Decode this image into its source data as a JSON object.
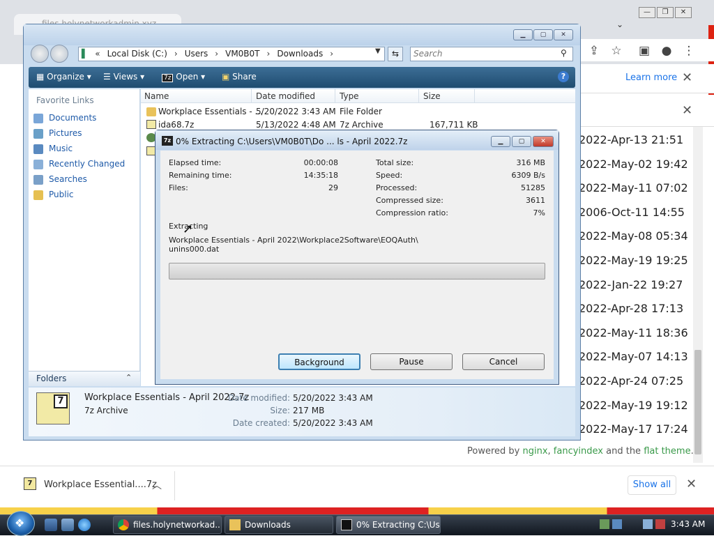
{
  "chrome": {
    "tab_title": "files.holynetworkadmin.xyz",
    "learn_more": "Learn more",
    "dates": [
      "2022-Apr-13 21:51",
      "2022-May-02 19:42",
      "2022-May-11 07:02",
      "2006-Oct-11 14:55",
      "2022-May-08 05:34",
      "2022-May-19 19:25",
      "2022-Jan-22 19:27",
      "2022-Apr-28 17:13",
      "2022-May-11 18:36",
      "2022-May-07 14:13",
      "2022-Apr-24 07:25",
      "2022-May-19 19:12",
      "2022-May-17 17:24"
    ],
    "powered_prefix": "Powered by ",
    "powered_nginx": "nginx",
    "powered_comma": ", ",
    "powered_fancyindex": "fancyindex",
    "powered_and": " and the ",
    "powered_flat": "flat theme",
    "powered_end": "."
  },
  "download_bar": {
    "file_name": "Workplace Essential....7z",
    "show_all": "Show all"
  },
  "explorer": {
    "address": [
      "Local Disk (C:)",
      "Users",
      "VM0B0T",
      "Downloads"
    ],
    "search_placeholder": "Search",
    "toolbar": {
      "organize": "Organize",
      "views": "Views",
      "open": "Open",
      "share": "Share"
    },
    "favorite_links_title": "Favorite Links",
    "favorites": [
      "Documents",
      "Pictures",
      "Music",
      "Recently Changed",
      "Searches",
      "Public"
    ],
    "folders_label": "Folders",
    "columns": {
      "name": "Name",
      "date": "Date modified",
      "type": "Type",
      "size": "Size"
    },
    "files": [
      {
        "name": "Workplace Essentials - ...",
        "date": "5/20/2022 3:43 AM",
        "type": "File Folder",
        "size": ""
      },
      {
        "name": "ida68.7z",
        "date": "5/13/2022 4:48 AM",
        "type": "7z Archive",
        "size": "167,711 KB"
      }
    ],
    "details": {
      "name": "Workplace Essentials - April 2022.7z",
      "type": "7z Archive",
      "date_modified_label": "Date modified:",
      "date_modified": "5/20/2022 3:43 AM",
      "size_label": "Size:",
      "size": "217 MB",
      "date_created_label": "Date created:",
      "date_created": "5/20/2022 3:43 AM"
    }
  },
  "dialog": {
    "title": "0% Extracting C:\\Users\\VM0B0T\\Do ... ls - April 2022.7z",
    "icon_text": "7z",
    "left_stats": [
      {
        "label": "Elapsed time:",
        "value": "00:00:08"
      },
      {
        "label": "Remaining time:",
        "value": "14:35:18"
      },
      {
        "label": "Files:",
        "value": "29"
      }
    ],
    "right_stats": [
      {
        "label": "Total size:",
        "value": "316 MB"
      },
      {
        "label": "Speed:",
        "value": "6309 B/s"
      },
      {
        "label": "Processed:",
        "value": "51285"
      },
      {
        "label": "Compressed size:",
        "value": "3611"
      },
      {
        "label": "Compression ratio:",
        "value": "7%"
      }
    ],
    "action": "Extracting",
    "path_line1": "Workplace Essentials - April 2022\\Workplace2Software\\EOQAuth\\",
    "path_line2": "unins000.dat",
    "progress_fraction": 0.0,
    "buttons": {
      "background": "Background",
      "pause": "Pause",
      "cancel": "Cancel"
    }
  },
  "taskbar": {
    "items": [
      "files.holynetworkad...",
      "Downloads",
      "0% Extracting C:\\Us..."
    ],
    "clock": "3:43 AM"
  },
  "colors": {
    "accent": "#1a73e8",
    "explorer_frame": "#c9dcef",
    "command_bar": "#2b5a80",
    "link_green": "#3a9a4a"
  }
}
